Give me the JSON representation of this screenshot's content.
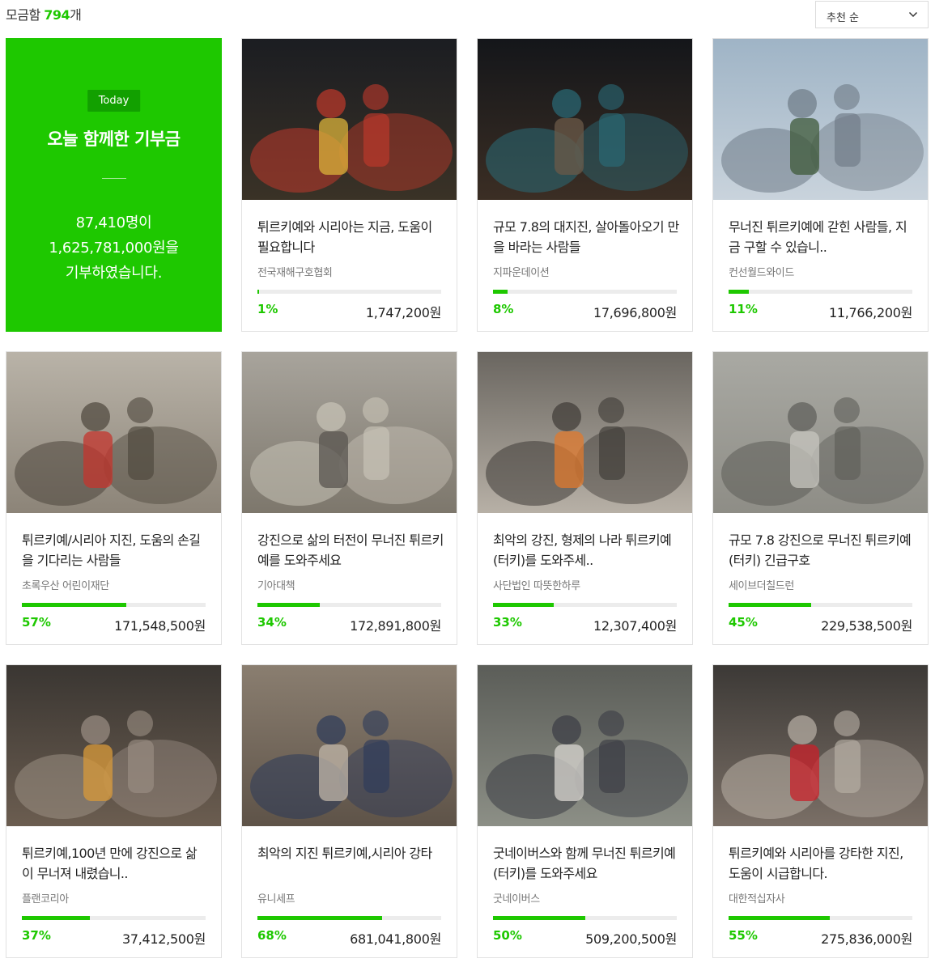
{
  "header": {
    "count_prefix": "모금함",
    "count_value": "794",
    "count_suffix": "개",
    "sort_label": "추천 순"
  },
  "today": {
    "badge": "Today",
    "title": "오늘 함께한 기부금",
    "line1": "87,410명이",
    "line2": "1,625,781,000원을",
    "line3": "기부하였습니다."
  },
  "colors": {
    "accent": "#1ec800",
    "accent_dark": "#12a000",
    "track": "#ececec"
  },
  "cards": [
    {
      "title": "튀르키예와 시리아는 지금, 도움이 필요합니다",
      "org": "전국재해구호협회",
      "percent_label": "1%",
      "percent": 1,
      "amount": "1,747,200원",
      "photo": "night-rescue-crowd"
    },
    {
      "title": "규모 7.8의 대지진, 살아돌아오기 만을 바라는 사람들",
      "org": "지파운데이션",
      "percent_label": "8%",
      "percent": 8,
      "amount": "17,696,800원",
      "photo": "night-rescue-carry"
    },
    {
      "title": "무너진 튀르키예에 갇힌 사람들, 지금 구할 수 있습니..",
      "org": "컨선월드와이드",
      "percent_label": "11%",
      "percent": 11,
      "amount": "11,766,200원",
      "photo": "tent-frame-workers"
    },
    {
      "title": "튀르키예/시리아 지진, 도움의 손길을 기다리는 사람들",
      "org": "초록우산 어린이재단",
      "percent_label": "57%",
      "percent": 57,
      "amount": "171,548,500원",
      "photo": "man-carrying-child"
    },
    {
      "title": "강진으로 삶의 터전이 무너진 튀르키예를 도와주세요",
      "org": "기아대책",
      "percent_label": "34%",
      "percent": 34,
      "amount": "172,891,800원",
      "photo": "collapsed-building-street"
    },
    {
      "title": "최악의 강진, 형제의 나라 튀르키예(터키)를 도와주세..",
      "org": "사단법인 따뜻한하루",
      "percent_label": "33%",
      "percent": 33,
      "amount": "12,307,400원",
      "photo": "rescuer-holding-child"
    },
    {
      "title": "규모 7.8 강진으로 무너진 튀르키예(터키) 긴급구호",
      "org": "세이브더칠드런",
      "percent_label": "45%",
      "percent": 45,
      "amount": "229,538,500원",
      "photo": "aerial-rubble-field"
    },
    {
      "title": "튀르키예,100년 만에 강진으로 삶이 무너져 내렸습니..",
      "org": "플랜코리아",
      "percent_label": "37%",
      "percent": 37,
      "amount": "37,412,500원",
      "photo": "grieving-father"
    },
    {
      "title": "최악의 지진 튀르키예,시리아 강타",
      "org": "유니세프",
      "percent_label": "68%",
      "percent": 68,
      "amount": "681,041,800원",
      "photo": "child-rescued-ruins"
    },
    {
      "title": "굿네이버스와 함께 무너진 튀르키예(터키)를 도와주세요",
      "org": "굿네이버스",
      "percent_label": "50%",
      "percent": 50,
      "amount": "509,200,500원",
      "photo": "crowd-lifting-slab"
    },
    {
      "title": "튀르키예와 시리아를 강타한 지진, 도움이 시급합니다.",
      "org": "대한적십자사",
      "percent_label": "55%",
      "percent": 55,
      "amount": "275,836,000원",
      "photo": "red-crescent-rescue"
    }
  ]
}
